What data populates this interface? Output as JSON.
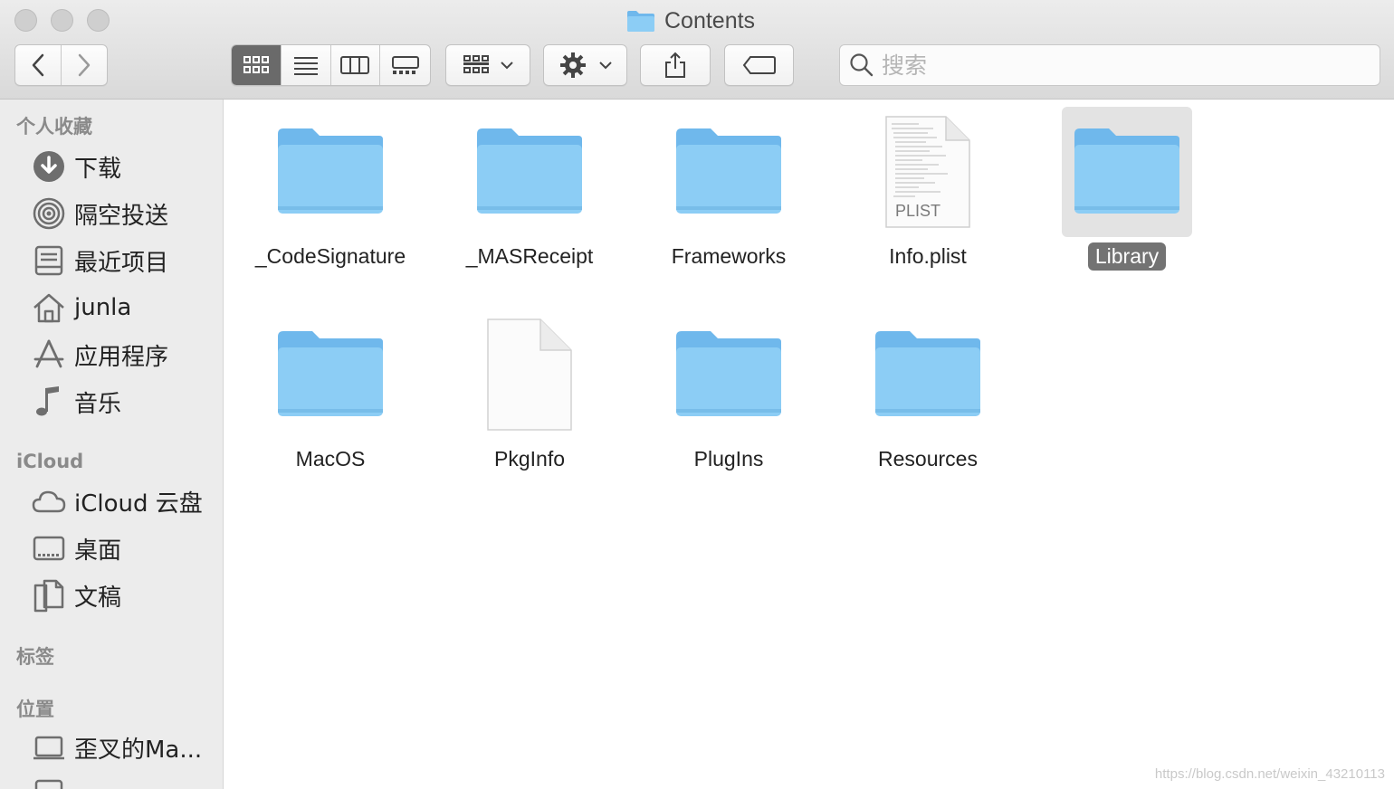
{
  "window": {
    "title": "Contents"
  },
  "search": {
    "placeholder": "搜索"
  },
  "sidebar": {
    "favorites_header": "个人收藏",
    "favorites": [
      {
        "label": "下载",
        "icon": "download-icon"
      },
      {
        "label": "隔空投送",
        "icon": "airdrop-icon"
      },
      {
        "label": "最近项目",
        "icon": "recents-icon"
      },
      {
        "label": "junla",
        "icon": "home-icon"
      },
      {
        "label": "应用程序",
        "icon": "applications-icon"
      },
      {
        "label": "音乐",
        "icon": "music-icon"
      }
    ],
    "icloud_header": "iCloud",
    "icloud": [
      {
        "label": "iCloud 云盘",
        "icon": "cloud-icon"
      },
      {
        "label": "桌面",
        "icon": "desktop-icon"
      },
      {
        "label": "文稿",
        "icon": "documents-icon"
      }
    ],
    "tags_header": "标签",
    "locations_header": "位置",
    "locations": [
      {
        "label": "歪叉的Ma...",
        "icon": "laptop-icon"
      }
    ]
  },
  "files": [
    {
      "name": "_CodeSignature",
      "type": "folder",
      "selected": false
    },
    {
      "name": "_MASReceipt",
      "type": "folder",
      "selected": false
    },
    {
      "name": "Frameworks",
      "type": "folder",
      "selected": false
    },
    {
      "name": "Info.plist",
      "type": "plist",
      "badge": "PLIST",
      "selected": false
    },
    {
      "name": "Library",
      "type": "folder",
      "selected": true
    },
    {
      "name": "MacOS",
      "type": "folder",
      "selected": false
    },
    {
      "name": "PkgInfo",
      "type": "document",
      "selected": false
    },
    {
      "name": "PlugIns",
      "type": "folder",
      "selected": false
    },
    {
      "name": "Resources",
      "type": "folder",
      "selected": false
    }
  ],
  "watermark": "https://blog.csdn.net/weixin_43210113",
  "colors": {
    "folder": "#8ccdf5",
    "folder_dark": "#6fb8ec",
    "selection_label": "#737373"
  }
}
